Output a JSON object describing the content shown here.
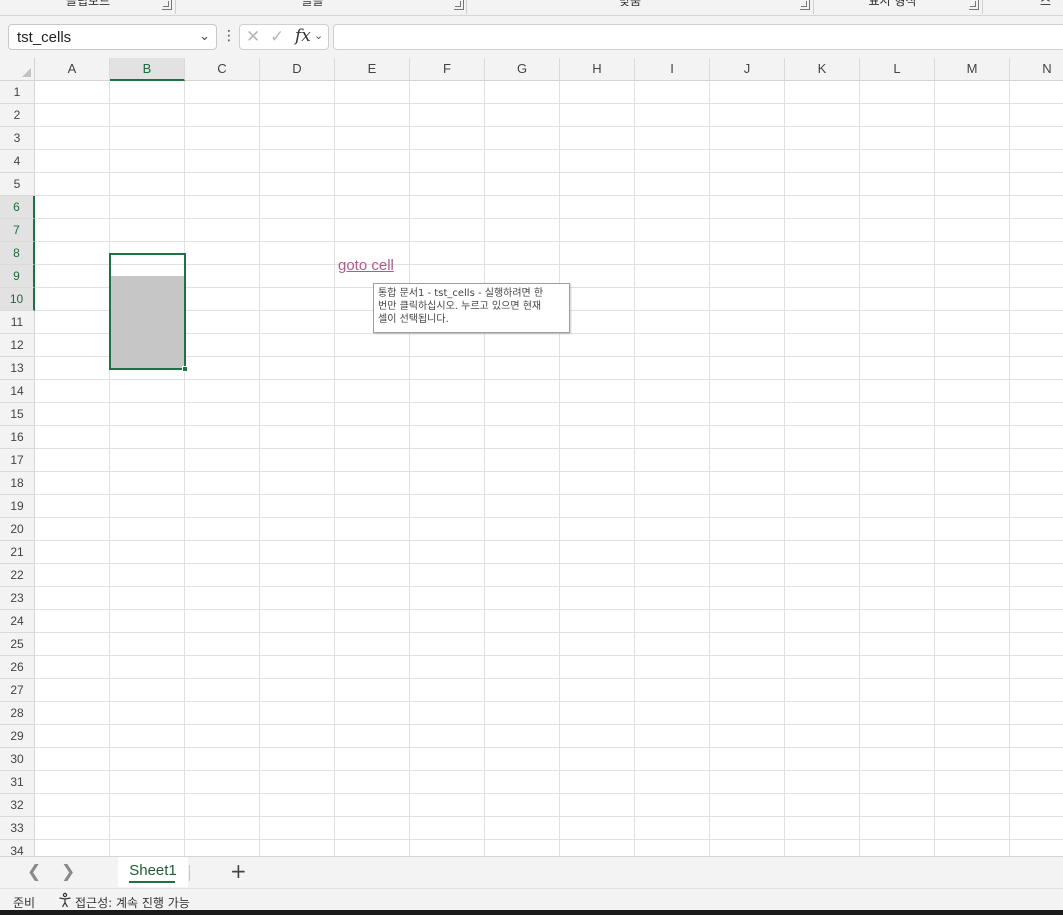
{
  "ribbon": {
    "groups": [
      "클립보드",
      "글꼴",
      "맞춤",
      "표시 형식",
      "스"
    ]
  },
  "formula_bar": {
    "name_box": "tst_cells",
    "fx_label": "fx",
    "formula": ""
  },
  "grid": {
    "columns": [
      "A",
      "B",
      "C",
      "D",
      "E",
      "F",
      "G",
      "H",
      "I",
      "J",
      "K",
      "L",
      "M",
      "N"
    ],
    "rows": [
      "1",
      "2",
      "3",
      "4",
      "5",
      "6",
      "7",
      "8",
      "9",
      "10",
      "11",
      "12",
      "13",
      "14",
      "15",
      "16",
      "17",
      "18",
      "19",
      "20",
      "21",
      "22",
      "23",
      "24",
      "25",
      "26",
      "27",
      "28",
      "29",
      "30",
      "31",
      "32",
      "33",
      "34"
    ],
    "selected_column": "B",
    "selected_rows": [
      "6",
      "7",
      "8",
      "9",
      "10"
    ],
    "selection_range": "B6:B10",
    "hyperlink_text": "goto cell",
    "hyperlink_color": "#b05a8e",
    "tooltip": {
      "line1": "통합 문서1 - tst_cells - 실행하려면 한",
      "line2": "번만 클릭하십시오. 누르고 있으면 현재",
      "line3": "셀이 선택됩니다."
    }
  },
  "sheet_tabs": {
    "tabs": [
      "Sheet1"
    ],
    "active": "Sheet1",
    "add_label": "+"
  },
  "status": {
    "ready": "준비",
    "accessibility": "접근성: 계속 진행 가능"
  },
  "colors": {
    "accent": "#1e7145",
    "selection_fill": "#c6c6c6",
    "chrome": "#f3f3f3"
  }
}
